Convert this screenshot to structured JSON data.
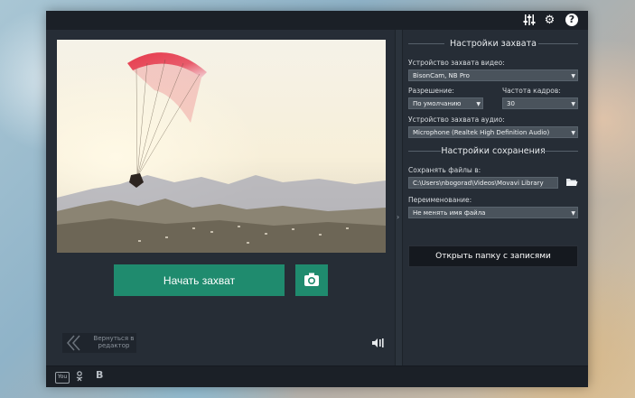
{
  "capture": {
    "start_label": "Начать захват",
    "back_label": "Вернуться в редактор"
  },
  "settings": {
    "capture_title": "Настройки захвата",
    "video_device_label": "Устройство захвата видео:",
    "video_device_value": "BisonCam, NB Pro",
    "resolution_label": "Разрешение:",
    "resolution_value": "По умолчанию",
    "framerate_label": "Частота кадров:",
    "framerate_value": "30",
    "audio_device_label": "Устройство захвата аудио:",
    "audio_device_value": "Microphone (Realtek High Definition Audio)",
    "save_title": "Настройки сохранения",
    "save_to_label": "Сохранять файлы в:",
    "save_to_value": "C:\\Users\\nbogorad\\Videos\\Movavi Library",
    "rename_label": "Переименование:",
    "rename_value": "Не менять имя файла",
    "open_folder_label": "Открыть папку с записями"
  },
  "icons": {
    "titlebar": [
      "equalizer-icon",
      "gear-icon",
      "help-icon"
    ],
    "bottombar": [
      "youtube-icon",
      "odnoklassniki-icon",
      "vk-icon"
    ],
    "bottombar_vk_letter": "В",
    "bottombar_youtube_text": "You"
  },
  "colors": {
    "accent": "#1f8b6e",
    "window_bg": "#262d36",
    "bar_bg": "#1b2027"
  }
}
